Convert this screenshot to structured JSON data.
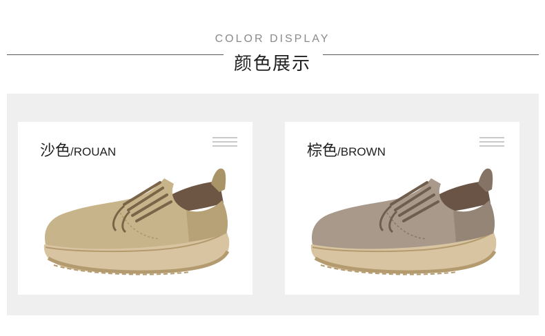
{
  "header": {
    "subtitle": "COLOR DISPLAY",
    "title": "颜色展示"
  },
  "cards": [
    {
      "title_cn": "沙色",
      "title_en": "/ROUAN",
      "shoe_icon": "shoe-image-sand",
      "colors": {
        "upper": "#c8b48a",
        "upper_dark": "#a99468",
        "sole": "#d8c4a0",
        "sole_dark": "#b39a6f",
        "lining": "#6e5644",
        "lace": "#7a6548"
      }
    },
    {
      "title_cn": "棕色",
      "title_en": "/BROWN",
      "shoe_icon": "shoe-image-brown",
      "colors": {
        "upper": "#a8998a",
        "upper_dark": "#857466",
        "sole": "#d8c4a0",
        "sole_dark": "#b39a6f",
        "lining": "#6a5446",
        "lace": "#6f5e4e"
      }
    }
  ]
}
